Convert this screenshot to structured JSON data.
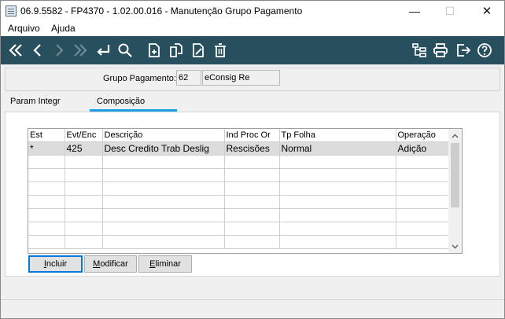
{
  "window": {
    "title": "06.9.5582 - FP4370 - 1.02.00.016 - Manutenção Grupo Pagamento",
    "minimize_glyph": "—",
    "maximize_glyph": "☐",
    "close_glyph": "✕"
  },
  "menu": {
    "items": [
      {
        "label": "Arquivo"
      },
      {
        "label": "Ajuda"
      }
    ]
  },
  "toolbar": {
    "icons": [
      "first-record-icon",
      "previous-record-icon",
      "next-record-icon",
      "last-record-icon",
      "return-icon",
      "search-icon",
      "new-document-icon",
      "copy-document-icon",
      "edit-document-icon",
      "delete-icon",
      "structure-icon",
      "print-icon",
      "exit-icon",
      "help-icon"
    ],
    "bg_color": "#274f5e"
  },
  "header": {
    "group_label": "Grupo Pagamento:",
    "group_code": "62",
    "group_name": "eConsig Re"
  },
  "tabs": [
    {
      "label": "Param Integr",
      "active": false
    },
    {
      "label": "Composição",
      "active": true
    }
  ],
  "grid": {
    "columns": [
      "Est",
      "Evt/Enc",
      "Descrição",
      "Ind Proc Or",
      "Tp Folha",
      "Operação"
    ],
    "rows": [
      {
        "est": "*",
        "evt": "425",
        "descricao": "Desc Credito Trab Deslig",
        "ind_proc": "Rescisões",
        "tp_folha": "Normal",
        "operacao": "Adição"
      }
    ],
    "empty_rows": 7
  },
  "buttons": {
    "incluir_first": "I",
    "incluir_rest": "ncluir",
    "modificar_first": "M",
    "modificar_rest": "odificar",
    "eliminar_first": "E",
    "eliminar_rest": "liminar"
  },
  "colors": {
    "accent": "#1ea0e6",
    "selection": "#dcdcdc"
  }
}
